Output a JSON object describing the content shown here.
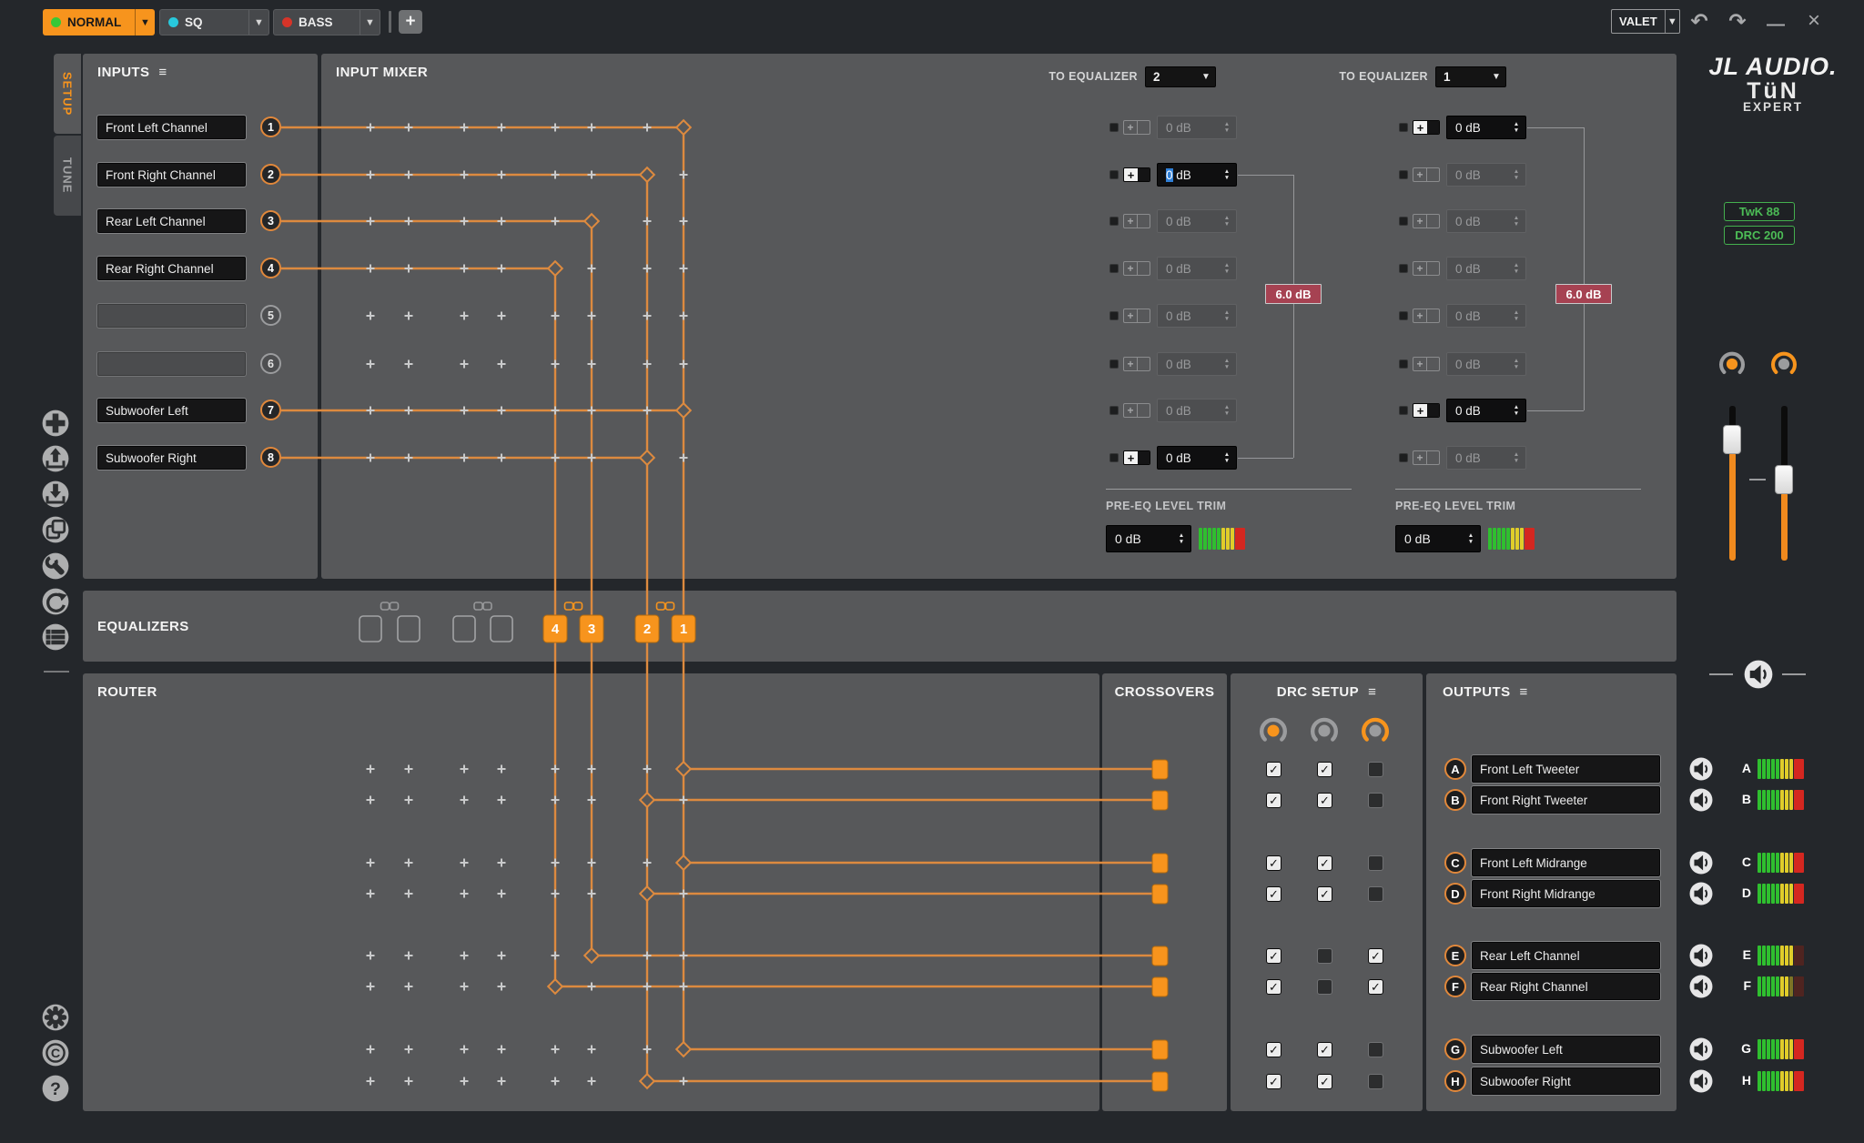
{
  "titlebar": {
    "presets": [
      {
        "label": "NORMAL",
        "led_color": "#37c837",
        "active": true
      },
      {
        "label": "SQ",
        "led_color": "#28c8dc",
        "active": false
      },
      {
        "label": "BASS",
        "led_color": "#d63429",
        "active": false
      }
    ],
    "add_button": "+",
    "valet_label": "VALET"
  },
  "branding": {
    "line1": "JL AUDIO.",
    "line2": "TüN",
    "line3": "EXPERT"
  },
  "devices": [
    {
      "label": "TwK 88"
    },
    {
      "label": "DRC 200"
    }
  ],
  "side_tabs": [
    {
      "label": "SETUP",
      "active": true
    },
    {
      "label": "TUNE",
      "active": false
    }
  ],
  "rail_icons_top": [
    "add",
    "load-from-device",
    "save-to-device",
    "copy",
    "tools",
    "restore",
    "preset-list"
  ],
  "rail_icons_bottom": [
    "settings",
    "about",
    "help"
  ],
  "inputs": {
    "title": "INPUTS",
    "channels": [
      {
        "num": "1",
        "name": "Front Left Channel",
        "connected": true
      },
      {
        "num": "2",
        "name": "Front Right Channel",
        "connected": true
      },
      {
        "num": "3",
        "name": "Rear Left Channel",
        "connected": true
      },
      {
        "num": "4",
        "name": "Rear Right Channel",
        "connected": true
      },
      {
        "num": "5",
        "name": "",
        "connected": false
      },
      {
        "num": "6",
        "name": "",
        "connected": false
      },
      {
        "num": "7",
        "name": "Subwoofer Left",
        "connected": true
      },
      {
        "num": "8",
        "name": "Subwoofer Right",
        "connected": true
      }
    ]
  },
  "input_mixer": {
    "title": "INPUT MIXER",
    "buses": [
      {
        "label": "TO EQUALIZER",
        "selected": "2",
        "rows": [
          {
            "gain": "0 dB",
            "active": false
          },
          {
            "gain": "0 dB",
            "active": true,
            "editing": true
          },
          {
            "gain": "0 dB",
            "active": false
          },
          {
            "gain": "0 dB",
            "active": false
          },
          {
            "gain": "0 dB",
            "active": false
          },
          {
            "gain": "0 dB",
            "active": false
          },
          {
            "gain": "0 dB",
            "active": false
          },
          {
            "gain": "0 dB",
            "active": true
          }
        ],
        "sum_badge": "6.0 dB",
        "trim_label": "PRE-EQ LEVEL TRIM",
        "trim_value": "0 dB"
      },
      {
        "label": "TO EQUALIZER",
        "selected": "1",
        "rows": [
          {
            "gain": "0 dB",
            "active": true
          },
          {
            "gain": "0 dB",
            "active": false
          },
          {
            "gain": "0 dB",
            "active": false
          },
          {
            "gain": "0 dB",
            "active": false
          },
          {
            "gain": "0 dB",
            "active": false
          },
          {
            "gain": "0 dB",
            "active": false
          },
          {
            "gain": "0 dB",
            "active": true
          },
          {
            "gain": "0 dB",
            "active": false
          }
        ],
        "sum_badge": "6.0 dB",
        "trim_label": "PRE-EQ LEVEL TRIM",
        "trim_value": "0 dB"
      }
    ]
  },
  "equalizers": {
    "title": "EQUALIZERS",
    "banks": [
      {
        "linked": false,
        "slots": [
          "",
          ""
        ]
      },
      {
        "linked": false,
        "slots": [
          "",
          ""
        ]
      },
      {
        "linked": true,
        "slots": [
          "4",
          "3"
        ]
      },
      {
        "linked": true,
        "slots": [
          "2",
          "1"
        ]
      }
    ]
  },
  "router": {
    "title": "ROUTER"
  },
  "crossovers": {
    "title": "CROSSOVERS"
  },
  "drc_setup": {
    "title": "DRC SETUP",
    "knobs": [
      "orange-center",
      "plain",
      "orange-ring"
    ]
  },
  "outputs": {
    "title": "OUTPUTS",
    "channels": [
      {
        "letter": "A",
        "name": "Front Left Tweeter",
        "drc": [
          true,
          true,
          false
        ],
        "meter": "bright"
      },
      {
        "letter": "B",
        "name": "Front Right Tweeter",
        "drc": [
          true,
          true,
          false
        ],
        "meter": "bright"
      },
      {
        "letter": "C",
        "name": "Front Left Midrange",
        "drc": [
          true,
          true,
          false
        ],
        "meter": "bright"
      },
      {
        "letter": "D",
        "name": "Front Right Midrange",
        "drc": [
          true,
          true,
          false
        ],
        "meter": "bright"
      },
      {
        "letter": "E",
        "name": "Rear Left Channel",
        "drc": [
          true,
          false,
          true
        ],
        "meter": "red-dim"
      },
      {
        "letter": "F",
        "name": "Rear Right Channel",
        "drc": [
          true,
          false,
          true
        ],
        "meter": "dim"
      },
      {
        "letter": "G",
        "name": "Subwoofer Left",
        "drc": [
          true,
          true,
          false
        ],
        "meter": "bright"
      },
      {
        "letter": "H",
        "name": "Subwoofer Right",
        "drc": [
          true,
          true,
          false
        ],
        "meter": "bright"
      }
    ]
  },
  "routing": {
    "input_to_eq": {
      "1": 1,
      "2": 2,
      "3": 3,
      "4": 4,
      "7": 1,
      "8": 2
    },
    "output_from_eq": {
      "A": 1,
      "B": 2,
      "C": 1,
      "D": 2,
      "E": 3,
      "F": 4,
      "G": 1,
      "H": 2
    }
  },
  "colors": {
    "accent": "#f7941d",
    "wire": "#dd8a3f",
    "badge": "#a64252",
    "meter_green": "#2fbf2f",
    "meter_yellow": "#e0cd2a",
    "meter_red": "#d42720",
    "meter_red_dim": "#4f2420",
    "meter_yellow_dim": "#7d7426",
    "device_green": "#44b04e"
  }
}
